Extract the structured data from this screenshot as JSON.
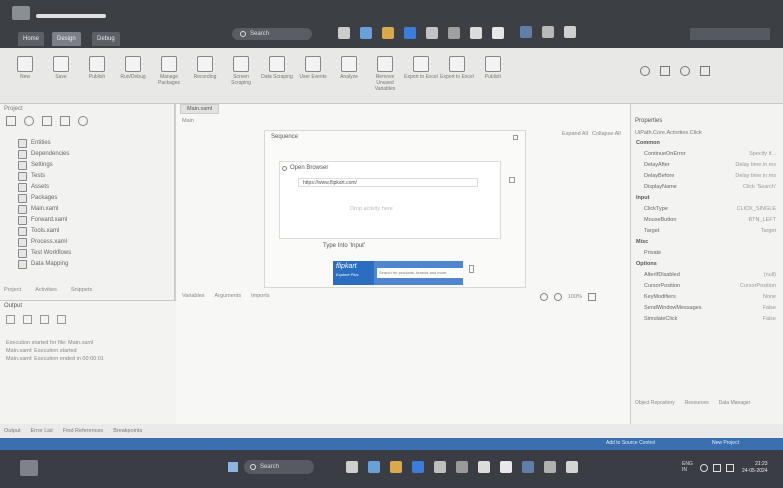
{
  "taskbar_top": {
    "search_text": "Search",
    "tabs": [
      "Home",
      "Design",
      "Debug"
    ]
  },
  "ribbon": {
    "items": [
      "New",
      "Save",
      "Publish",
      "Run/Debug",
      "Manage Packages",
      "Recording",
      "Screen Scraping",
      "Data Scraping",
      "User Events",
      "Analyze",
      "Remove Unused Variables",
      "Export to Excel",
      "Export to Excel",
      "Publish"
    ]
  },
  "left_panel": {
    "title": "Project",
    "tree": [
      "Entities",
      "Dependencies",
      "Settings",
      "Tests",
      "Assets",
      "Packages",
      "Main.xaml",
      "Forward.xaml",
      "Tools.xaml",
      "Process.xaml",
      "Test Workflows",
      "Data Mapping"
    ],
    "bottom_tabs": [
      "Project",
      "Activities",
      "Snippets"
    ],
    "output_title": "Output",
    "output_lines": [
      "Execution started for file: Main.xaml",
      "Main.xaml: Execution started",
      "Main.xaml: Execution ended in 00:00:01"
    ]
  },
  "designer": {
    "tab": "Main.xaml",
    "breadcrumb": "Main",
    "expand_all": "Expand All",
    "collapse_all": "Collapse All",
    "sequence_label": "Sequence",
    "browser_label": "Open Browser",
    "url_text": "https://www.flipkart.com/",
    "drop_text": "Drop activity here",
    "type_label": "Type Into 'Input'",
    "site_brand": "flipkart",
    "site_tagline": "Explore Plus",
    "site_search": "Search for products, brands and more",
    "bottom_tabs": [
      "Variables",
      "Arguments",
      "Imports"
    ],
    "zoom": "100%"
  },
  "properties": {
    "title": "Properties",
    "activity_path": "UiPath.Core.Activities.Click",
    "sections": [
      {
        "name": "Common",
        "rows": [
          [
            "ContinueOnError",
            "Specify if..."
          ],
          [
            "DelayAfter",
            "Delay time in ms"
          ],
          [
            "DelayBefore",
            "Delay time in ms"
          ],
          [
            "DisplayName",
            "Click 'Search'"
          ]
        ]
      },
      {
        "name": "Input",
        "rows": [
          [
            "ClickType",
            "CLICK_SINGLE"
          ],
          [
            "MouseButton",
            "BTN_LEFT"
          ],
          [
            "Target",
            "Target"
          ]
        ]
      },
      {
        "name": "Misc",
        "rows": [
          [
            "Private",
            ""
          ]
        ]
      },
      {
        "name": "Options",
        "rows": [
          [
            "AlterIfDisabled",
            "(null)"
          ],
          [
            "CursorPosition",
            "CursorPosition"
          ],
          [
            "KeyModifiers",
            "None"
          ],
          [
            "SendWindowMessages",
            "False"
          ],
          [
            "SimulateClick",
            "False"
          ]
        ]
      }
    ],
    "bottom": [
      "Object Repository",
      "Resources",
      "Data Manager"
    ]
  },
  "status_bar": {
    "items": [
      "Output",
      "Error List",
      "Find References",
      "Breakpoints"
    ]
  },
  "win_status": [
    "Add to Source Control",
    "New Project"
  ],
  "taskbar_bottom": {
    "search_text": "Search",
    "lang": "ENG\nIN",
    "time": "21:23",
    "date": "24-05-2024"
  },
  "colors": {
    "taskbar": "#3a3d43",
    "accent": "#3a6fb0",
    "flipkart": "#2b6ec1"
  }
}
